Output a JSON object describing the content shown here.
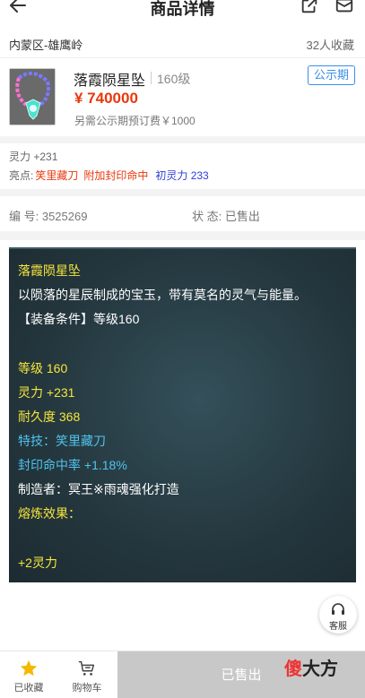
{
  "header": {
    "title": "商品详情"
  },
  "seller": {
    "area": "内蒙区-雄鹰岭",
    "favorites": "32人收藏"
  },
  "item": {
    "name": "落霞陨星坠",
    "level": "160级",
    "badge": "公示期",
    "price": "¥ 740000",
    "prefee": "另需公示期预订费￥1000"
  },
  "stats": {
    "lingli": "灵力 +231",
    "highlight_label": "亮点:",
    "highlights": [
      "笑里藏刀",
      "附加封印命中",
      "初灵力 233"
    ]
  },
  "codes": {
    "number": "编 号: 3525269",
    "status": "状 态: 已售出"
  },
  "detail": {
    "name": "落霞陨星坠",
    "desc": "以陨落的星辰制成的宝玉，带有莫名的灵气与能量。",
    "requirement": "【装备条件】等级160",
    "level": "等级 160",
    "lingli": "灵力 +231",
    "durability": "耐久度 368",
    "skill": "特技：笑里藏刀",
    "seal": "封印命中率 +1.18%",
    "maker": "制造者：冥王※雨魂强化打造",
    "refine": "熔炼效果：",
    "refine_value": "+2灵力"
  },
  "service": {
    "label": "客服"
  },
  "bottom": {
    "fav_label": "已收藏",
    "cart_label": "购物车",
    "sold_label": "已售出",
    "watermark_red": "傻",
    "watermark_dark": "大方"
  },
  "colors": {
    "accent_red": "#e8380d",
    "badge_blue": "#3a8ee6",
    "panel_bg": "#24363d",
    "panel_yellow": "#f5e53c",
    "panel_cyan": "#4fc3ef",
    "star_gold": "#f5b800"
  }
}
